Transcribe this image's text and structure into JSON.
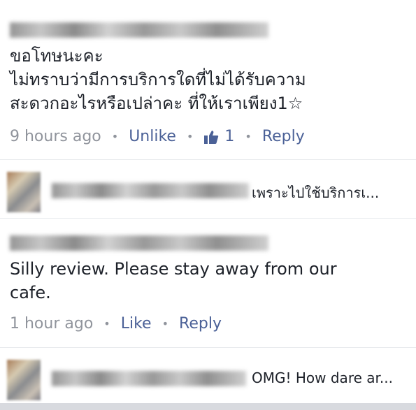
{
  "comment1": {
    "lines": [
      "ขอโทษนะคะ",
      "ไม่ทราบว่ามีการบริการใดที่ไม่ได้รับความ",
      "สะดวกอะไรหรือเปล่าคะ ที่ให้เราเพียง1☆"
    ],
    "time": "9 hours ago",
    "unlike_label": "Unlike",
    "like_count": "1",
    "reply_label": "Reply"
  },
  "reply1": {
    "text": "เพราะไปใช้บริการเ..."
  },
  "comment2": {
    "line1": "Silly review. Please stay away from our",
    "line2": "cafe.",
    "time": "1 hour ago",
    "like_label": "Like",
    "reply_label": "Reply"
  },
  "reply2": {
    "text": "OMG! How dare ar..."
  },
  "separator": "•",
  "icons": [
    "thumbs-up-icon"
  ]
}
